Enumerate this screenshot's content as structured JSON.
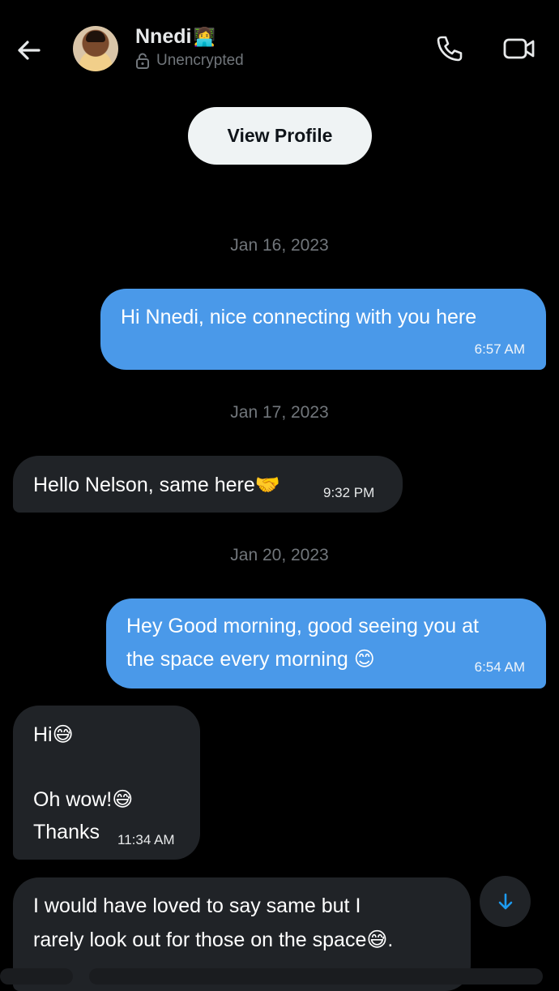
{
  "header": {
    "contact_name": "Nnedi",
    "name_emoji": "👩‍💻",
    "encryption_status": "Unencrypted"
  },
  "view_profile_label": "View Profile",
  "messages": [
    {
      "date": "Jan 16, 2023"
    },
    {
      "direction": "sent",
      "text": "Hi Nnedi, nice connecting with you here",
      "time": "6:57 AM"
    },
    {
      "date": "Jan 17, 2023"
    },
    {
      "direction": "received",
      "text": "Hello Nelson, same here🤝",
      "time": "9:32 PM"
    },
    {
      "date": "Jan 20, 2023"
    },
    {
      "direction": "sent",
      "line1": "Hey Good morning, good seeing you at",
      "line2": "the space every morning 😊",
      "time": "6:54 AM"
    },
    {
      "direction": "received",
      "line1": "Hi😅",
      "line2": "Oh wow!😅",
      "line3": "Thanks",
      "time": "11:34 AM"
    },
    {
      "direction": "received",
      "line1": "I would have loved to say same but I",
      "line2": "rarely look out for those on the space😅."
    }
  ],
  "colors": {
    "background": "#000000",
    "sent_bubble": "#4a99e9",
    "received_bubble": "#202327",
    "muted_text": "#71767b"
  }
}
